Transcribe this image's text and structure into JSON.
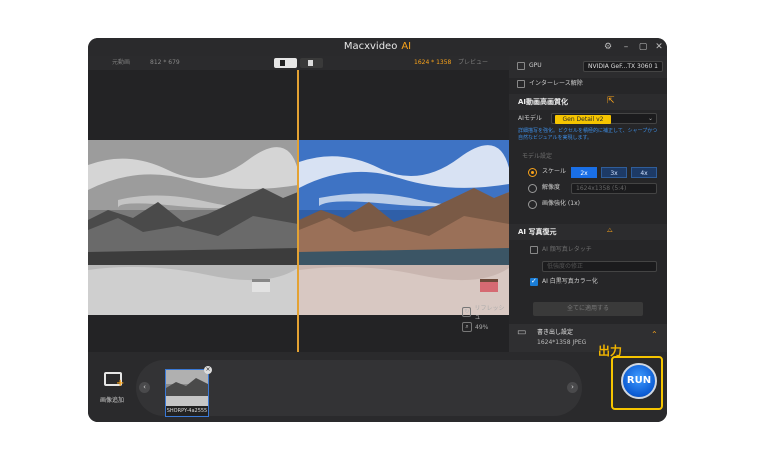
{
  "window": {
    "title": "Macxvideo",
    "title_ai": "AI",
    "controls": [
      "⚙",
      "–",
      "▢",
      "✕"
    ]
  },
  "preview": {
    "original_label": "元動画",
    "original_res": "812 * 679",
    "output_res": "1624 * 1358",
    "preview_label": "プレビュー",
    "reset_label": "リフレッシュ",
    "zoom_label": "49%"
  },
  "panel": {
    "gpu_label": "GPU",
    "gpu_value": "NVIDIA GeF...TX 3060 1",
    "deinterlace_label": "インターレース解除",
    "enhance_header": "AI動画高画質化",
    "ai_model_label": "AIモデル",
    "ai_model_value": "Gen Detail v2",
    "description": "詳細描写を強化。ピクセルを積極的に補正して、シャープかつ自然なビジュアルを実現します。",
    "model_settings_label": "モデル設定",
    "scale_label": "スケール",
    "scale_options": [
      "2x",
      "3x",
      "4x"
    ],
    "resolution_label": "解像度",
    "resolution_placeholder": "1624x1358 (5:4)",
    "quality_label": "画像強化 (1x)",
    "restore_header": "AI 写真復元",
    "face_label": "AI 顔写真レタッチ",
    "face_select": "低強度の修正",
    "colorize_label": "AI 白黒写真カラー化",
    "apply_label": "全てに適用する"
  },
  "output": {
    "label": "書き出し設定",
    "detail": "1624*1358 JPEG",
    "annotation": "出力"
  },
  "bottom": {
    "add_label": "画像追加",
    "thumb_caption": "SHORPY-4a2555",
    "run_label": "RUN"
  },
  "colors": {
    "accent_orange": "#f7a21b",
    "badge_yellow": "#f5c400",
    "run_blue": "#0b5bd3"
  }
}
